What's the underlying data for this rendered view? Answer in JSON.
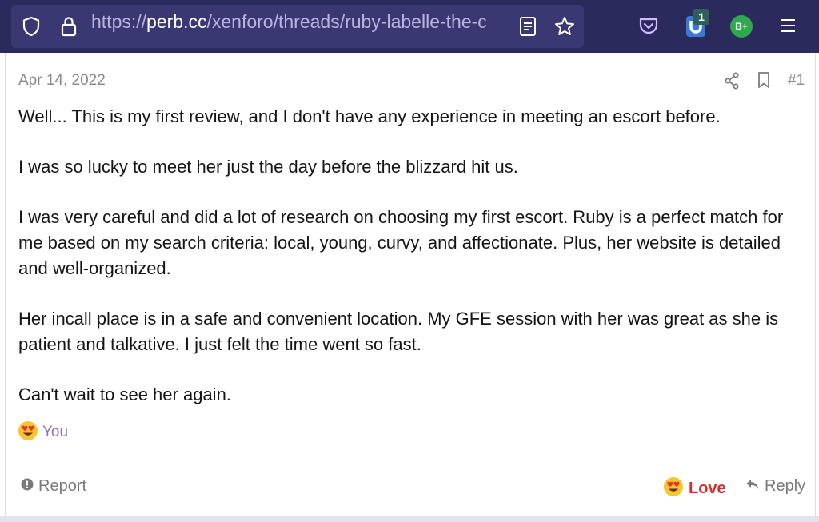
{
  "browser": {
    "url_prefix": "https://",
    "url_host": "perb.cc",
    "url_path": "/xenforo/threads/ruby-labelle-the-c",
    "extension_badge": "1",
    "avatar_label": "B+",
    "accent": "#2b2a5c"
  },
  "post": {
    "date": "Apr 14, 2022",
    "number": "#1",
    "paragraphs": [
      "Well... This is my first review, and I don't have any experience in meeting an escort before.",
      "I was so lucky to meet her just the day before the blizzard hit us.",
      "I was very careful and did a lot of research on choosing my first escort. Ruby is a perfect match for me based on my search criteria: local, young, curvy, and affectionate. Plus, her website is detailed and well-organized.",
      "Her incall place is in a safe and convenient location. My GFE session with her was great as she is patient and talkative. I just felt the time went so fast.",
      "Can't wait to see her again."
    ],
    "reaction_by": "You"
  },
  "actions": {
    "report": "Report",
    "love": "Love",
    "reply": "Reply"
  },
  "icons": [
    "shield-icon",
    "lock-icon",
    "reader-icon",
    "star-icon",
    "pocket-icon",
    "extension-icon",
    "menu-icon",
    "share-icon",
    "bookmark-icon",
    "love-emoji-icon",
    "report-icon",
    "reply-icon"
  ]
}
